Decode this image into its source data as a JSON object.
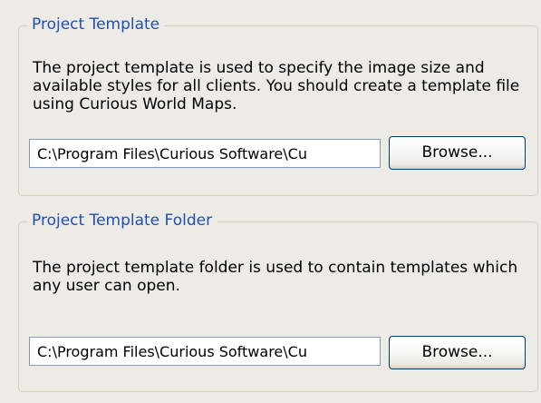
{
  "project_template": {
    "title": "Project Template",
    "description": "The project template is used to specify the image size and available styles for all clients. You should create a template file using Curious World Maps.",
    "path_value": "C:\\Program Files\\Curious Software\\Cu",
    "browse_label": "Browse..."
  },
  "project_template_folder": {
    "title": "Project Template Folder",
    "description": "The project template folder is used to contain templates which any user can open.",
    "path_value": "C:\\Program Files\\Curious Software\\Cu",
    "browse_label": "Browse..."
  }
}
